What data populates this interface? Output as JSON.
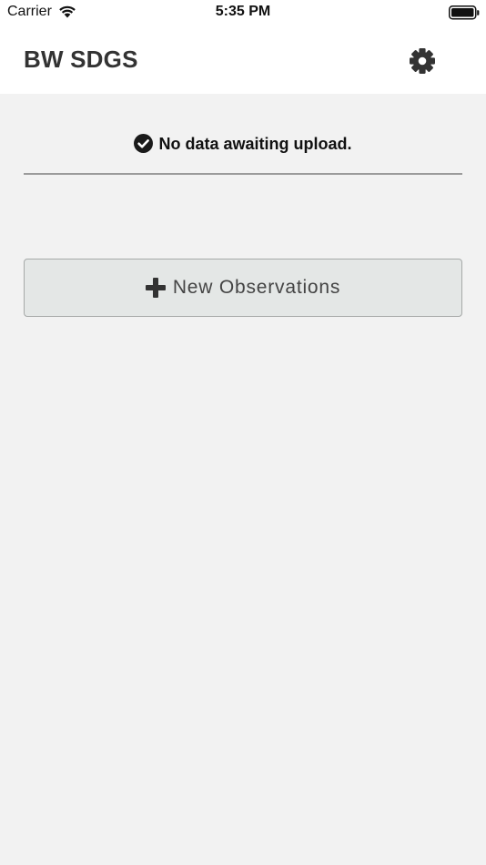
{
  "status_bar": {
    "carrier": "Carrier",
    "time": "5:35 PM"
  },
  "header": {
    "title": "BW SDGS",
    "settings_icon": "gear-icon"
  },
  "upload_status": {
    "icon": "check-circle-icon",
    "message": "No data awaiting upload."
  },
  "actions": {
    "new_observations_icon": "plus-icon",
    "new_observations_label": "New Observations"
  },
  "colors": {
    "background": "#f2f2f2",
    "header_background": "#ffffff",
    "title": "#333333",
    "button_background": "#e4e7e6",
    "button_border": "#a6a9a8"
  }
}
